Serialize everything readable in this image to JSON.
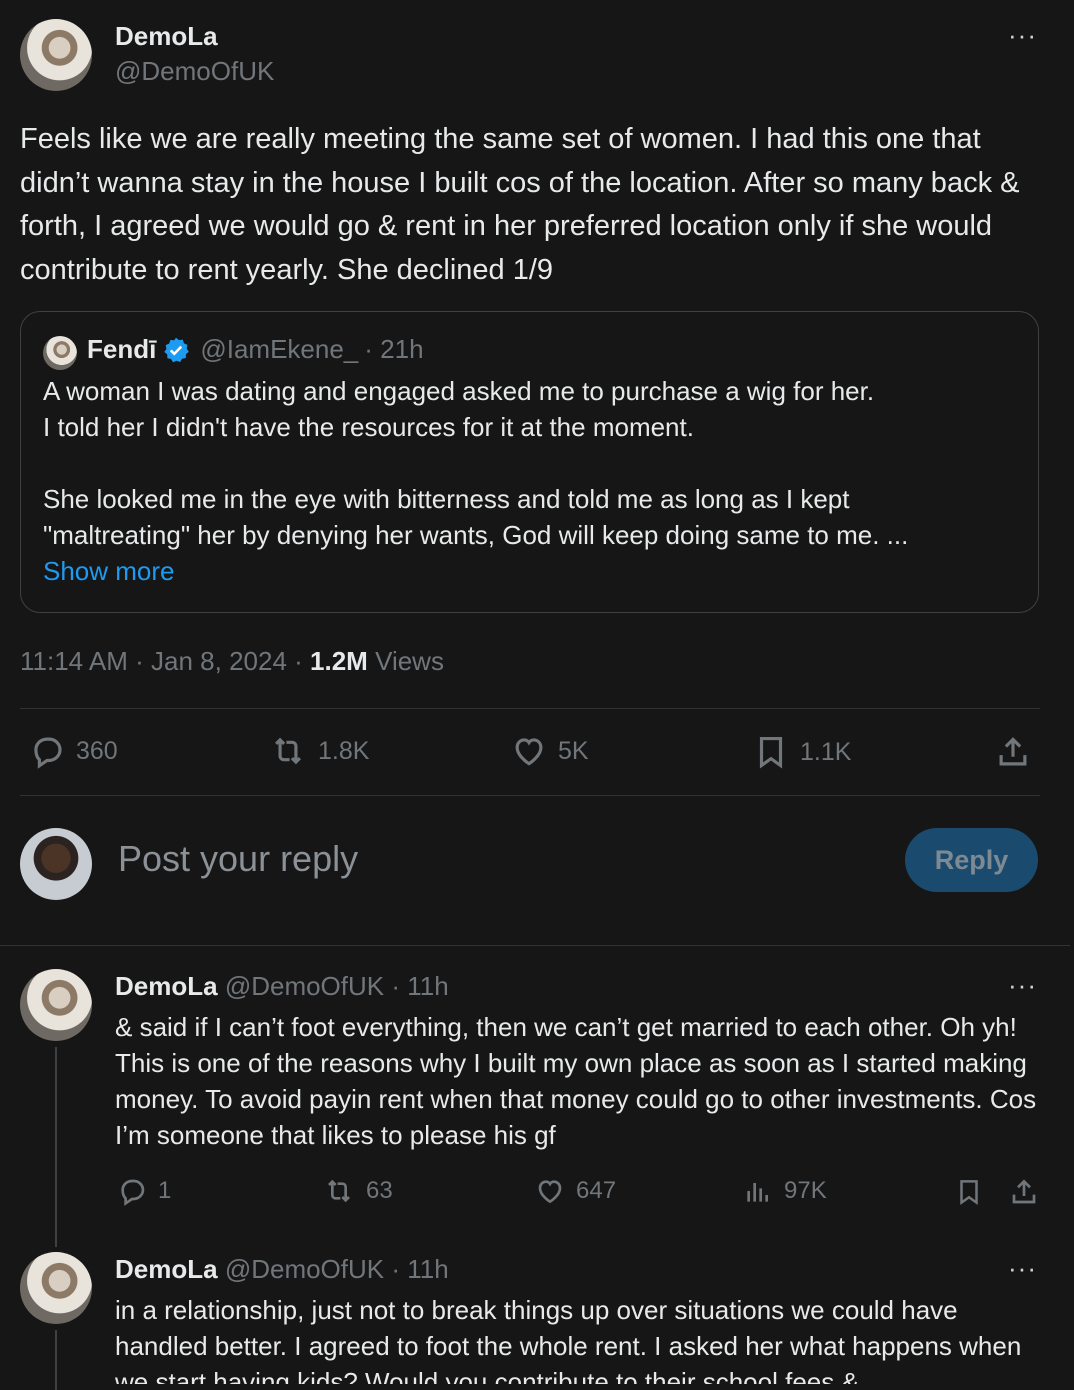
{
  "main_tweet": {
    "name": "DemoLa",
    "handle": "@DemoOfUK",
    "text": "Feels like we are really meeting the same set of women. I had this one that didn’t wanna stay in the house I built cos of the location. After so many back & forth, I agreed we would go & rent in her preferred location only if she would contribute to rent yearly. She declined 1/9",
    "quoted": {
      "name": "Fendī",
      "handle": "@IamEkene_",
      "time": "· 21h",
      "line1": "A woman I was dating and engaged asked me to purchase a wig for her.",
      "line2": "I told her I didn't have the resources for it at the moment.",
      "line3": "She looked me in the eye with bitterness and told me as long as I kept",
      "line4": "\"maltreating\" her by denying her wants, God will keep doing same to me. ...",
      "show_more": "Show more"
    },
    "timestamp": "11:14 AM · Jan 8, 2024 · ",
    "views_count": "1.2M",
    "views_label": " Views",
    "stats": {
      "replies": "360",
      "reposts": "1.8K",
      "likes": "5K",
      "bookmarks": "1.1K"
    }
  },
  "reply_box": {
    "placeholder": "Post your reply",
    "button": "Reply"
  },
  "thread": [
    {
      "name": "DemoLa",
      "handle": "@DemoOfUK · 11h",
      "text": "& said if I can’t foot everything, then we can’t get married to each other. Oh yh! This is one of the reasons why I built my own place as soon as I started making money. To avoid payin rent when that money could go to other investments. Cos I’m someone that likes to please his gf",
      "stats": {
        "replies": "1",
        "reposts": "63",
        "likes": "647",
        "views": "97K"
      }
    },
    {
      "name": "DemoLa",
      "handle": "@DemoOfUK · 11h",
      "text": "in a relationship, just not to break things up over situations we could have handled better. I agreed to foot the whole rent. I asked her what happens when we start having kids? Would you contribute to their school fees &"
    }
  ],
  "colors": {
    "background": "#161616",
    "accent": "#1d9bf0",
    "muted": "#71767b",
    "reply_button": "#1a4b6e"
  },
  "icons": [
    "more-icon",
    "verified-icon",
    "reply-icon",
    "repost-icon",
    "like-icon",
    "bookmark-icon",
    "share-icon",
    "views-icon"
  ]
}
